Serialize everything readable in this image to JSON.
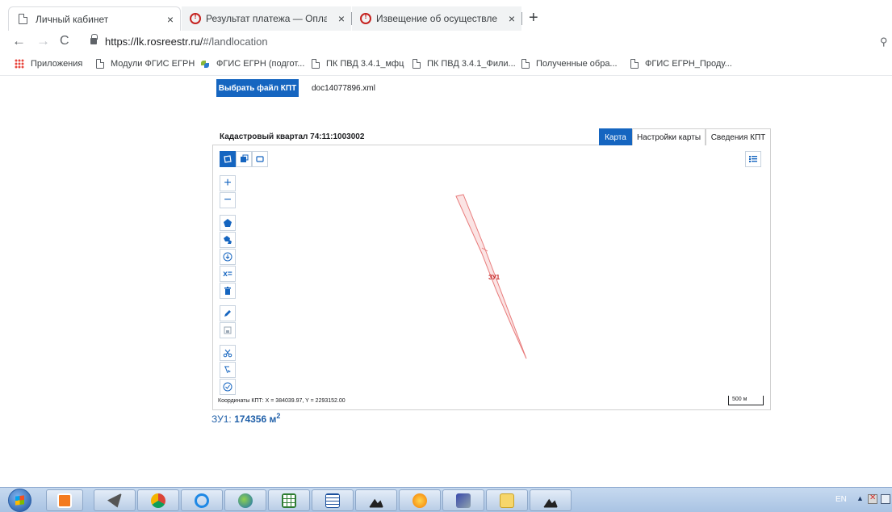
{
  "browser": {
    "tabs": [
      {
        "title": "Личный кабинет",
        "close": "×"
      },
      {
        "title": "Результат платежа — Оплата го",
        "close": "×"
      },
      {
        "title": "Извещение об осуществлении",
        "close": "×"
      }
    ],
    "new_tab": "+",
    "url_host": "https://lk.rosreestr.ru/",
    "url_path": "#/landlocation",
    "bookmarks": [
      "Приложения",
      "Модули ФГИС ЕГРН",
      "ФГИС ЕГРН (подгот...",
      "ПК ПВД 3.4.1_мфц",
      "ПК ПВД 3.4.1_Фили...",
      "Полученные обра...",
      "ФГИС ЕГРН_Проду..."
    ]
  },
  "page": {
    "select_file_button": "Выбрать файл КПТ",
    "file_name": "doc14077896.xml",
    "panel_title": "Кадастровый квартал 74:11:1003002",
    "tabs": {
      "map": "Карта",
      "settings": "Настройки карты",
      "info": "Сведения КПТ"
    },
    "parcel_label": "ЗУ1",
    "coords_text": "Координаты КПТ: X = 384039.97, Y = 2293152.00",
    "scale_label": "500 м",
    "area": {
      "label": "ЗУ1:",
      "value": "174356",
      "unit": "м",
      "unit_power": "2"
    },
    "colors": {
      "accent": "#1565c0",
      "parcel_stroke": "#e87c7c",
      "area_text": "#1f5fa8"
    }
  },
  "taskbar": {
    "language": "EN"
  }
}
